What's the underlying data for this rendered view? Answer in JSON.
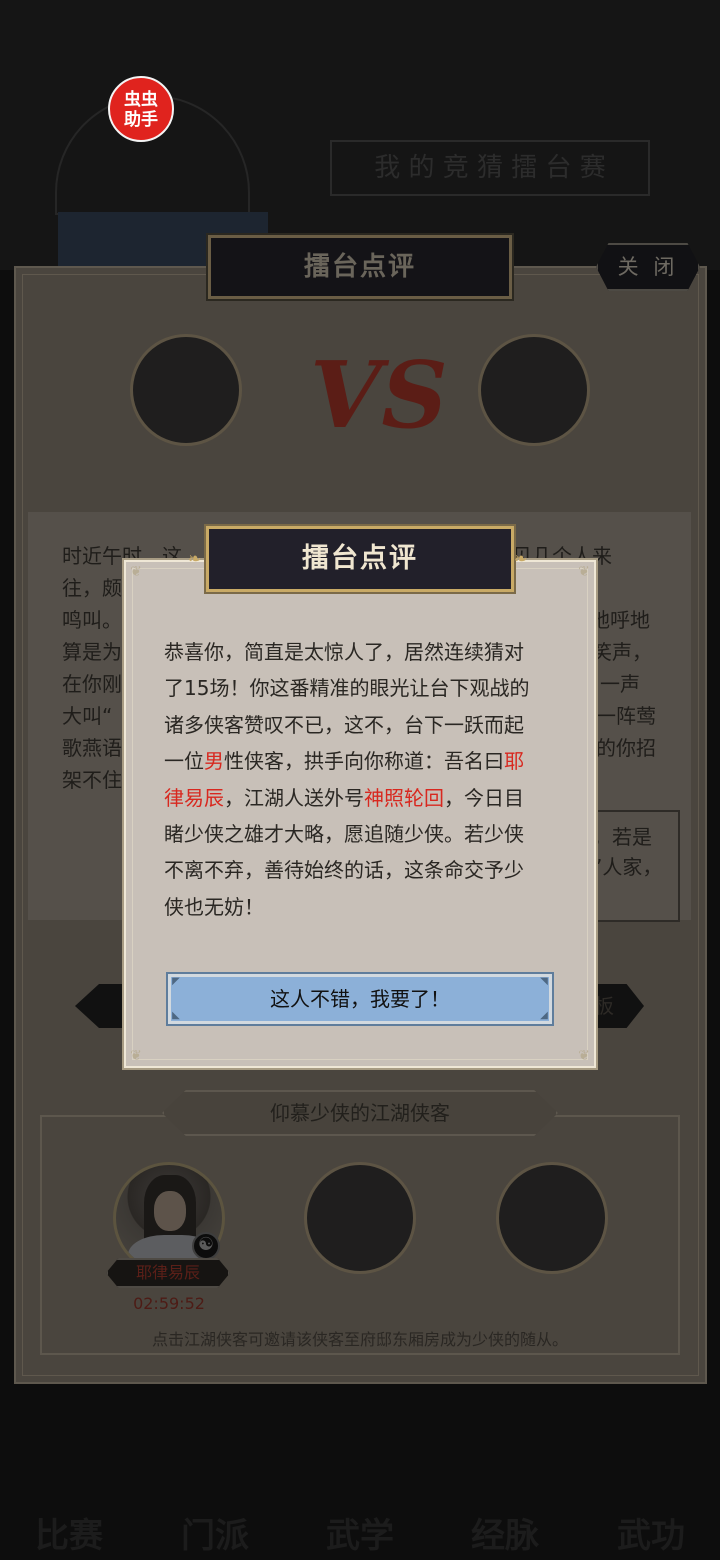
{
  "background": {
    "title": "擂台点评",
    "close_label": "关 闭",
    "top_banner_text": "我 的 竞 猜 擂 台 赛",
    "badge": {
      "line1": "虫虫",
      "line2": "助手"
    },
    "vs_label": "VS",
    "story_lines": [
      "时近午时，这",
      "往，颇",
      "鸣叫。",
      "算是为",
      "在你刚",
      "大叫“",
      "歌燕语",
      "架不住"
    ],
    "story_right_fragments": [
      "见几个人来",
      "地呼地",
      "笑声，",
      "一声",
      "一阵莺",
      "的你招"
    ],
    "side_box_lines": [
      "，若是",
      "”人家，"
    ],
    "mid_right_button": "板",
    "heroes_section_title": "仰慕少侠的江湖侠客",
    "hero": {
      "name": "耶律易辰",
      "timer": "02:59:52"
    },
    "hint": "点击江湖侠客可邀请该侠客至府邸东厢房成为少侠的随从。",
    "nav_labels": [
      "比赛",
      "门派",
      "武学",
      "经脉",
      "武功"
    ]
  },
  "modal": {
    "title": "擂台点评",
    "body": {
      "l1": "恭喜你，简直是太惊人了，居然连续猜对",
      "l2": "了15场！你这番精准的眼光让台下观战的",
      "l3": "诸多侠客赞叹不已，这不，台下一跃而起",
      "l4_a": "一位",
      "l4_hl1": "男",
      "l4_b": "性侠客，拱手向你称道：吾名曰",
      "l4_hl2": "耶",
      "l5_hl": "律易辰",
      "l5_a": "，江湖人送外号",
      "l5_hl2": "神照轮回",
      "l5_b": "，今日目",
      "l6": "睹少侠之雄才大略，愿追随少侠。若少侠",
      "l7": "不离不弃，善待始终的话，这条命交予少",
      "l8": "侠也无妨！"
    },
    "confirm_label": "这人不错，我要了！"
  },
  "colors": {
    "highlight": "#d8281f",
    "button": "#8cb0d8",
    "title_bg": "#22202a",
    "gold": "#c9aa66"
  }
}
